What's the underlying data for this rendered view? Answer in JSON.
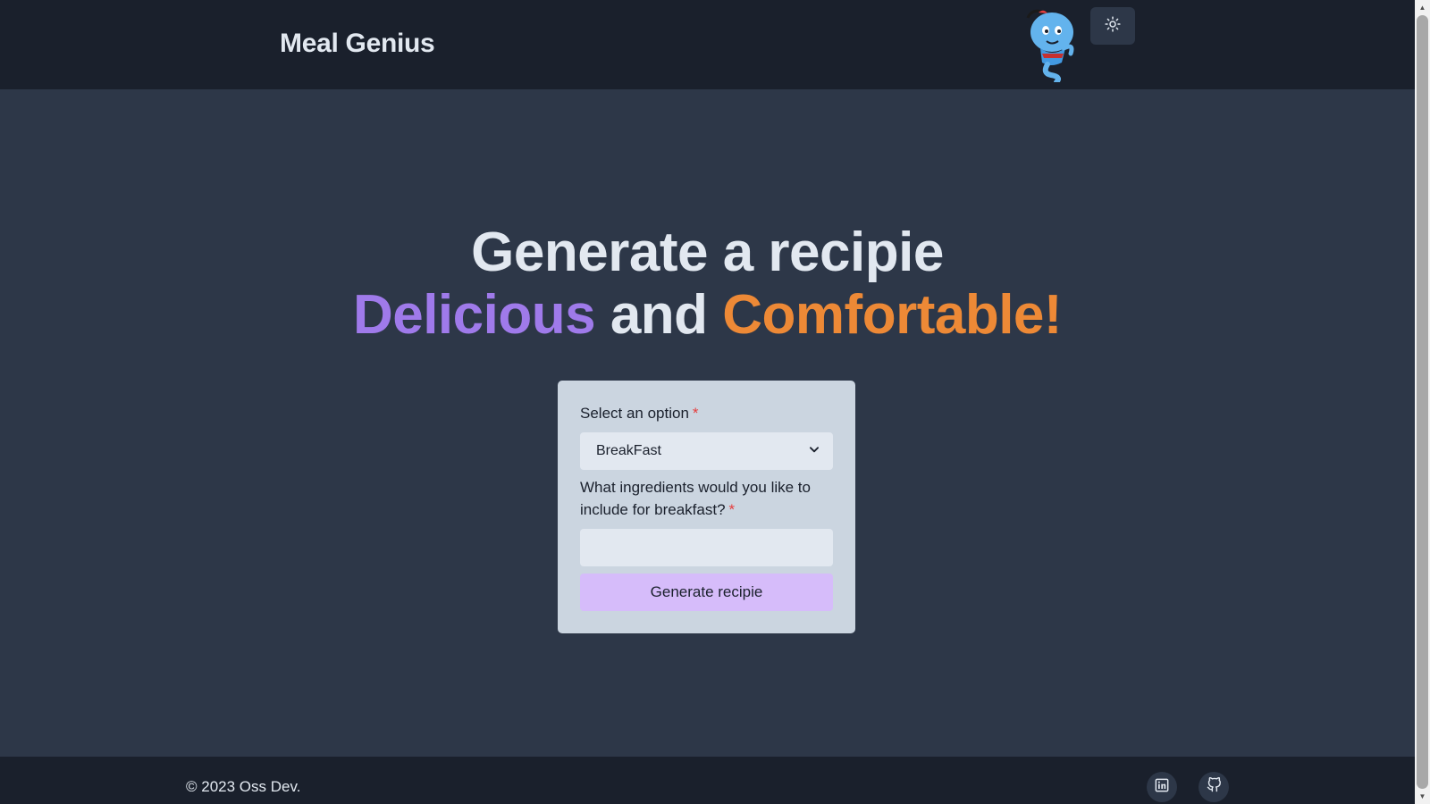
{
  "header": {
    "brand": "Meal Genius",
    "mascot_icon": "genie-mascot-icon",
    "theme_toggle_icon": "sun-icon"
  },
  "hero": {
    "line1": "Generate a recipie",
    "word_purple": "Delicious",
    "word_and": "and",
    "word_orange": "Comfortable!"
  },
  "form": {
    "select_label": "Select an option",
    "select_value": "BreakFast",
    "ingredients_label": "What ingredients would you like to include for breakfast?",
    "ingredients_value": "",
    "required_mark": "*",
    "submit_label": "Generate recipie"
  },
  "footer": {
    "copyright": "© 2023 Oss Dev.",
    "social_icons": [
      "linkedin-icon",
      "github-icon"
    ]
  },
  "colors": {
    "header_bg": "#1a202c",
    "main_bg": "#2d3748",
    "accent_purple": "#9f7aea",
    "accent_orange": "#ed8936",
    "button_bg": "#d6bcfa",
    "card_bg": "#cbd5e0"
  }
}
